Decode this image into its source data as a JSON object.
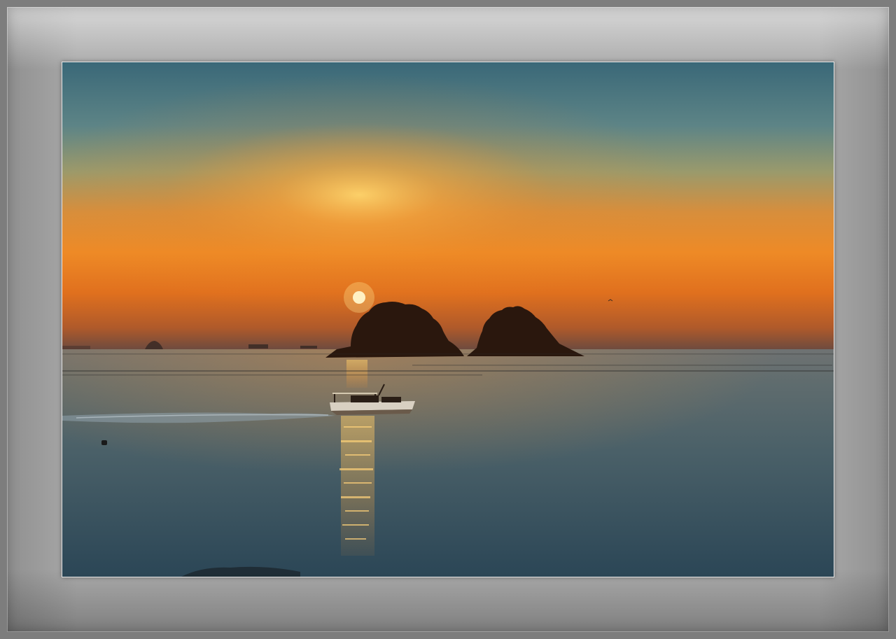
{
  "scene": {
    "subject": "sunset-over-sea",
    "colors": {
      "sky_top": "#3b6a7a",
      "sky_mid": "#8a8e66",
      "sky_glow": "#f2922a",
      "horizon": "#d9661c",
      "sun": "#fff8d6",
      "sea_near": "#2f4e5e",
      "sea_far": "#5a6a6a",
      "silhouette": "#2a170d",
      "frame": "#a9a9a9"
    }
  }
}
